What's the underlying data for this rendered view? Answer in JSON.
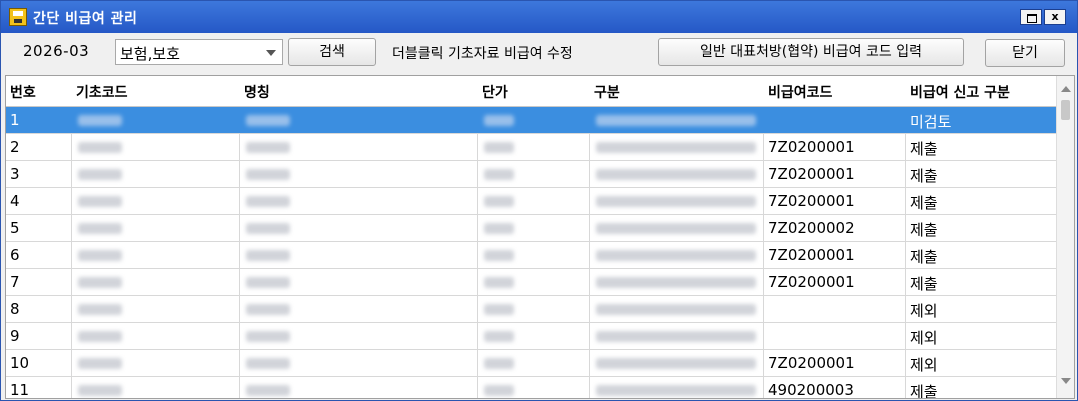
{
  "window": {
    "title": "간단 비급여 관리",
    "close_glyph": "x"
  },
  "toolbar": {
    "period": "2026-03",
    "category": "보험,보호",
    "search_label": "검색",
    "hint": "더블클릭 기초자료 비급여 수정",
    "register_label": "일반 대표처방(협약) 비급여 코드 입력",
    "close_label": "닫기"
  },
  "table": {
    "headers": [
      "번호",
      "기초코드",
      "명칭",
      "단가",
      "구분",
      "비급여코드",
      "비급여 신고 구분"
    ],
    "rows": [
      {
        "no": "1",
        "code": "",
        "status": "미검토"
      },
      {
        "no": "2",
        "code": "7Z0200001",
        "status": "제출"
      },
      {
        "no": "3",
        "code": "7Z0200001",
        "status": "제출"
      },
      {
        "no": "4",
        "code": "7Z0200001",
        "status": "제출"
      },
      {
        "no": "5",
        "code": "7Z0200002",
        "status": "제출"
      },
      {
        "no": "6",
        "code": "7Z0200001",
        "status": "제출"
      },
      {
        "no": "7",
        "code": "7Z0200001",
        "status": "제출"
      },
      {
        "no": "8",
        "code": "",
        "status": "제외"
      },
      {
        "no": "9",
        "code": "",
        "status": "제외"
      },
      {
        "no": "10",
        "code": "7Z0200001",
        "status": "제외"
      },
      {
        "no": "11",
        "code": "490200003",
        "status": "제출"
      }
    ]
  },
  "colors": {
    "title_bar": "#2f68d2",
    "selected_row": "#3b8ee0"
  },
  "icons": [
    "save-disk-icon",
    "maximize-icon",
    "close-icon",
    "dropdown-arrow-icon",
    "scroll-up-icon",
    "scroll-down-icon"
  ]
}
